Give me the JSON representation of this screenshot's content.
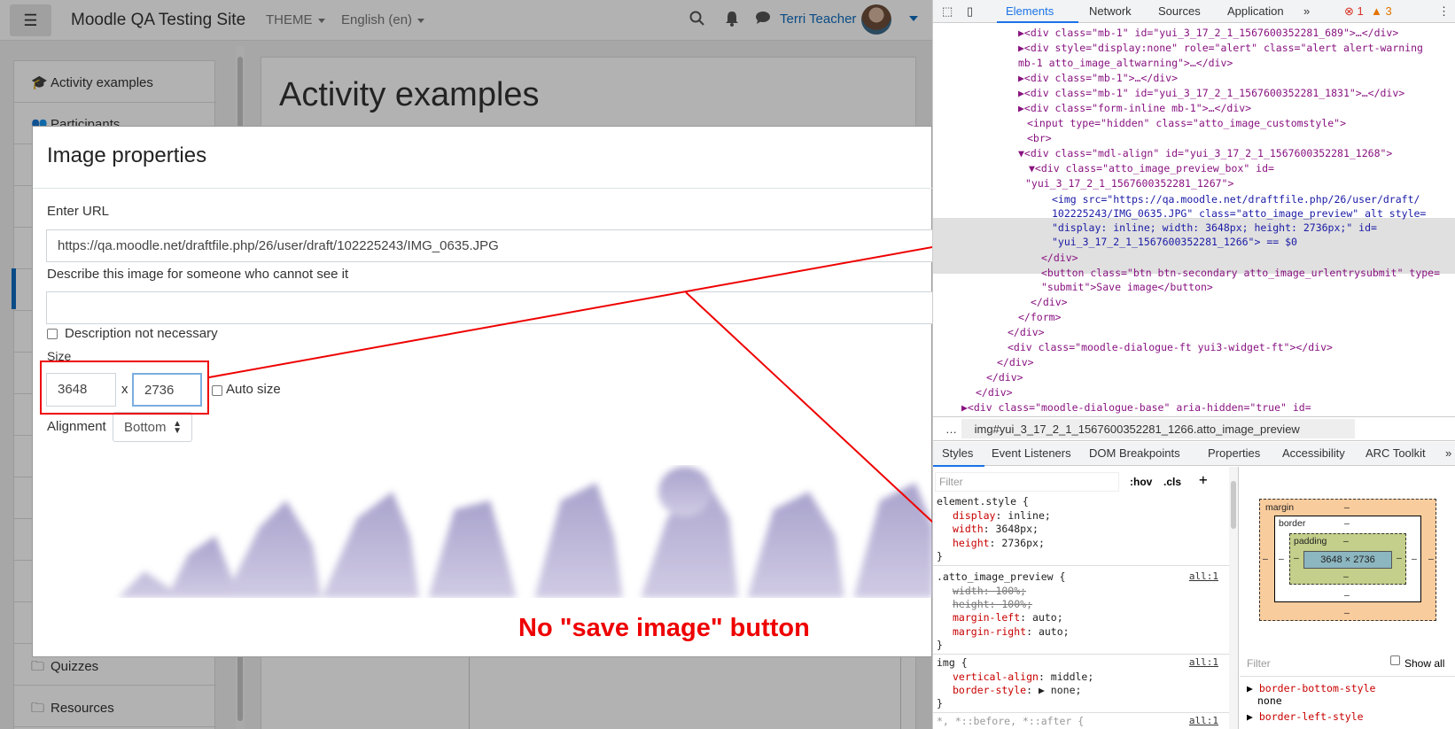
{
  "navbar": {
    "site_name": "Moodle QA Testing Site",
    "theme": "THEME",
    "language": "English (en)",
    "user_name": "Terri Teacher"
  },
  "drawer": {
    "items": [
      {
        "label": "Activity examples",
        "icon": "graduation-cap-icon"
      },
      {
        "label": "Participants",
        "icon": "users-icon"
      },
      {
        "label": "Quizzes",
        "icon": "folder-icon"
      },
      {
        "label": "Resources",
        "icon": "folder-icon"
      }
    ]
  },
  "main": {
    "title": "Activity examples"
  },
  "dialog": {
    "title": "Image properties",
    "url_label": "Enter URL",
    "url_value": "https://qa.moodle.net/draftfile.php/26/user/draft/102225243/IMG_0635.JPG",
    "alt_label": "Describe this image for someone who cannot see it",
    "alt_value": "",
    "presentation_label": "Description not necessary",
    "size_label": "Size",
    "width_value": "3648",
    "x_label": "x",
    "height_value": "2736",
    "auto_size_label": "Auto size",
    "alignment_label": "Alignment",
    "alignment_value": "Bottom"
  },
  "annotation": {
    "text": "No \"save image\" button",
    "color": "#e00000"
  },
  "devtools": {
    "tabs": [
      "Elements",
      "Network",
      "Sources",
      "Application"
    ],
    "errors": "1",
    "warnings": "3",
    "dom_lines": [
      "▶<div class=\"mb-1\" id=\"yui_3_17_2_1_1567600352281_689\">…</div>",
      "▶<div style=\"display:none\" role=\"alert\" class=\"alert alert-warning",
      "mb-1 atto_image_altwarning\">…</div>",
      "▶<div class=\"mb-1\">…</div>",
      "▶<div class=\"mb-1\" id=\"yui_3_17_2_1_1567600352281_1831\">…</div>",
      "▶<div class=\"form-inline mb-1\">…</div>",
      "<input type=\"hidden\" class=\"atto_image_customstyle\">",
      "<br>",
      "▼<div class=\"mdl-align\" id=\"yui_3_17_2_1_1567600352281_1268\">",
      "▼<div class=\"atto_image_preview_box\" id=",
      "\"yui_3_17_2_1_1567600352281_1267\">",
      "<img src=\"https://qa.moodle.net/draftfile.php/26/user/draft/",
      "102225243/IMG_0635.JPG\" class=\"atto_image_preview\" alt style=",
      "\"display: inline; width: 3648px; height: 2736px;\" id=",
      "\"yui_3_17_2_1_1567600352281_1266\"> == $0",
      "</div>",
      "<button class=\"btn btn-secondary atto_image_urlentrysubmit\" type=",
      "\"submit\">Save image</button>",
      "</div>",
      "</form>",
      "</div>",
      "<div class=\"moodle-dialogue-ft yui3-widget-ft\"></div>",
      "</div>",
      "</div>",
      "</div>",
      "▶<div class=\"moodle-dialogue-base\" aria-hidden=\"true\" id="
    ],
    "breadcrumb": "img#yui_3_17_2_1_1567600352281_1266.atto_image_preview",
    "styles_tabs": [
      "Styles",
      "Event Listeners",
      "DOM Breakpoints",
      "Properties",
      "Accessibility",
      "ARC Toolkit"
    ],
    "filter_placeholder": "Filter",
    "hov": ":hov",
    "cls": ".cls",
    "rules": {
      "element_selector": "element.style {",
      "el_display_prop": "display",
      "el_display_val": "inline;",
      "el_width_prop": "width",
      "el_width_val": "3648px;",
      "el_height_prop": "height",
      "el_height_val": "2736px;",
      "close": "}",
      "preview_selector": ".atto_image_preview {",
      "preview_source": "all:1",
      "pv_width": "width: 100%;",
      "pv_height": "height: 100%;",
      "pv_ml_prop": "margin-left",
      "pv_ml_val": "auto;",
      "pv_mr_prop": "margin-right",
      "pv_mr_val": "auto;",
      "img_selector": "img {",
      "img_source": "all:1",
      "img_va_prop": "vertical-align",
      "img_va_val": "middle;",
      "img_bs_prop": "border-style",
      "img_bs_val": "none;",
      "star_selector": "*, *::before, *::after {",
      "star_source": "all:1"
    },
    "box_model": {
      "margin": "margin",
      "border": "border",
      "padding": "padding",
      "content": "3648 × 2736",
      "dash": "–"
    },
    "computed_filter": "Filter",
    "show_all": "Show all",
    "computed_props": [
      {
        "name": "border-bottom-style",
        "value": "none"
      },
      {
        "name": "border-left-style",
        "value": "none"
      }
    ]
  }
}
